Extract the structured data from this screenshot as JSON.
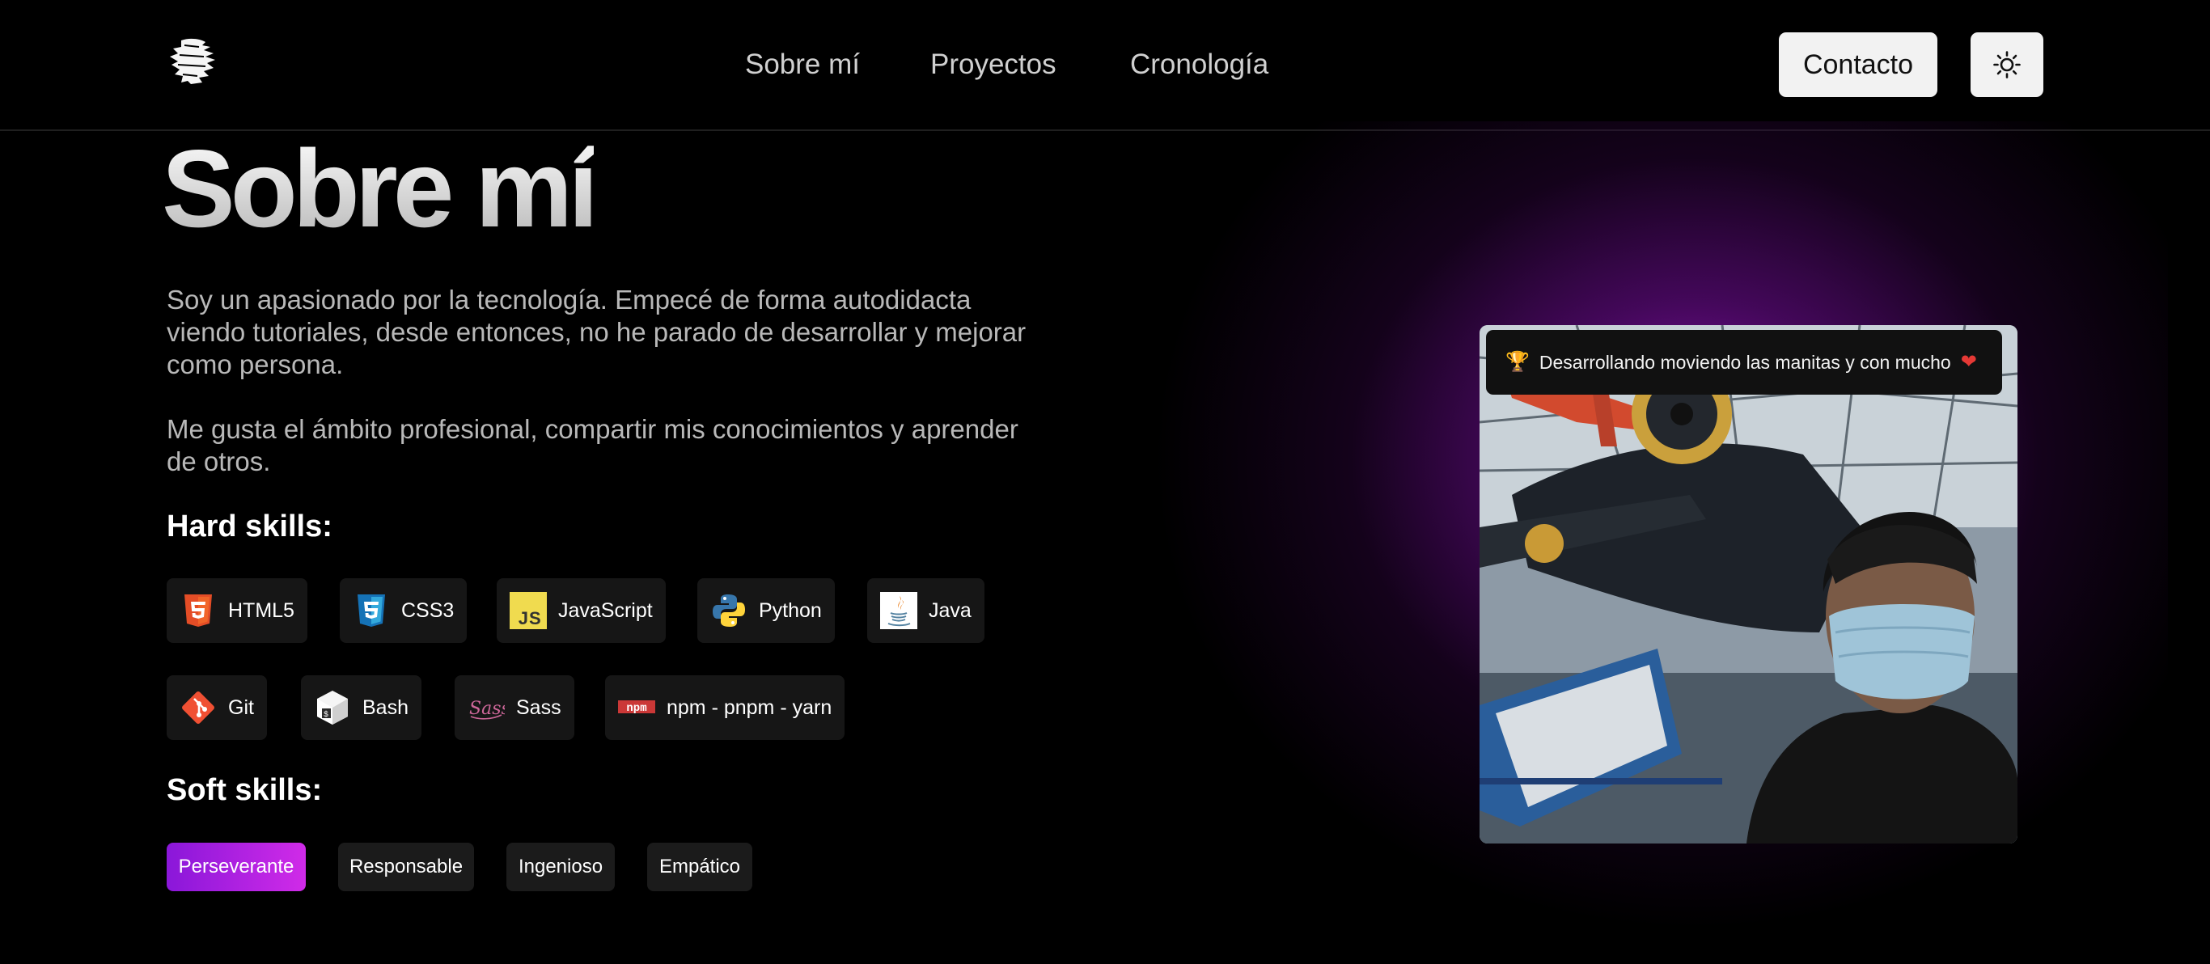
{
  "header": {
    "nav": [
      {
        "label": "Sobre mí"
      },
      {
        "label": "Proyectos"
      },
      {
        "label": "Cronología"
      }
    ],
    "contact_label": "Contacto",
    "theme_icon": "sun-icon"
  },
  "about": {
    "title": "Sobre mí",
    "paragraphs": [
      "Soy un apasionado por la tecnología. Empecé de forma autodidacta viendo tutoriales, desde entonces, no he parado de desarrollar y mejorar como persona.",
      "Me gusta el ámbito profesional, compartir mis conocimientos y aprender de otros."
    ],
    "hard_skills_heading": "Hard skills:",
    "hard_skills": [
      {
        "label": "HTML5",
        "icon": "html5-icon"
      },
      {
        "label": "CSS3",
        "icon": "css3-icon"
      },
      {
        "label": "JavaScript",
        "icon": "javascript-icon"
      },
      {
        "label": "Python",
        "icon": "python-icon"
      },
      {
        "label": "Java",
        "icon": "java-icon"
      },
      {
        "label": "Git",
        "icon": "git-icon"
      },
      {
        "label": "Bash",
        "icon": "bash-icon"
      },
      {
        "label": "Sass",
        "icon": "sass-icon"
      },
      {
        "label": "npm - pnpm - yarn",
        "icon": "npm-icon"
      }
    ],
    "soft_skills_heading": "Soft skills:",
    "soft_skills": [
      {
        "label": "Perseverante",
        "active": true
      },
      {
        "label": "Responsable",
        "active": false
      },
      {
        "label": "Ingenioso",
        "active": false
      },
      {
        "label": "Empático",
        "active": false
      }
    ]
  },
  "photo": {
    "caption": "Desarrollando moviendo las manitas y con mucho",
    "caption_leading_icon": "trophy-icon",
    "caption_trailing_icon": "heart-icon",
    "subject": "person-with-face-mask-in-aircraft-museum"
  },
  "colors": {
    "background": "#000000",
    "accent_purple": "#8a17d9",
    "accent_pink": "#d02be8",
    "chip_bg": "#161616",
    "button_bg": "#f2f2f2"
  }
}
